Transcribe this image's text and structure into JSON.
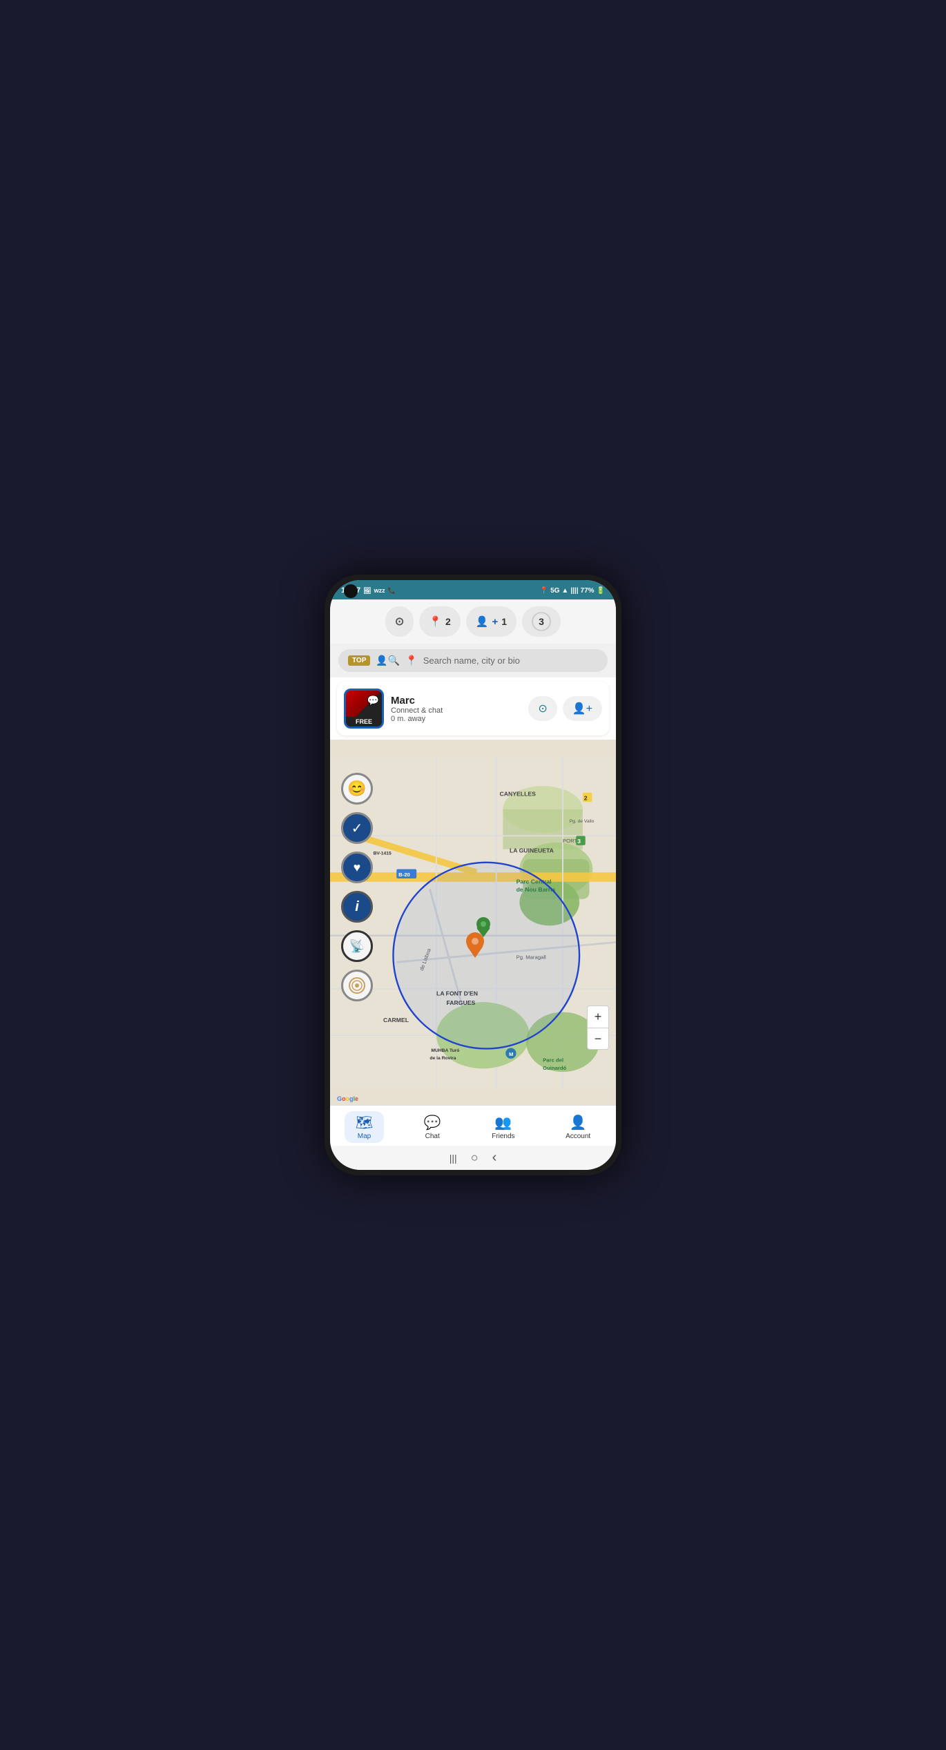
{
  "status_bar": {
    "time": "12:47",
    "network": "5G",
    "battery": "77%"
  },
  "top_actions": [
    {
      "id": "scan",
      "icon": "⊙",
      "label": "",
      "count": null
    },
    {
      "id": "messages",
      "icon": "📍",
      "label": "2",
      "count": 2
    },
    {
      "id": "add_friend",
      "icon": "👤+",
      "label": "1",
      "count": 1
    },
    {
      "id": "notifications",
      "icon": "③",
      "label": "3",
      "count": 3
    }
  ],
  "search": {
    "top_label": "TOP",
    "placeholder": "Search name, city or bio"
  },
  "user_card": {
    "name": "Marc",
    "action": "Connect & chat",
    "distance": "0 m. away",
    "free_badge": "FREE"
  },
  "map": {
    "area_labels": [
      "CANYELLES",
      "LA GUINEUETA",
      "Parc Central de Nou Barris",
      "PORTA",
      "LA FONT D'EN FARGUES",
      "CARMEL",
      "MUHBA Turó de la Rovira",
      "Parc del Guinardó",
      "Pg. de Vallo",
      "Pg. Maragall"
    ],
    "road_labels": [
      "BV-1415",
      "B-20"
    ],
    "zoom_plus": "+",
    "zoom_minus": "−"
  },
  "bottom_nav": {
    "items": [
      {
        "id": "map",
        "icon": "🗺",
        "label": "Map",
        "active": true
      },
      {
        "id": "chat",
        "icon": "💬",
        "label": "Chat",
        "active": false
      },
      {
        "id": "friends",
        "icon": "👥",
        "label": "Friends",
        "active": false
      },
      {
        "id": "account",
        "icon": "👤",
        "label": "Account",
        "active": false
      }
    ]
  },
  "home_indicator": {
    "back": "‹",
    "home": "○",
    "recents": "|||"
  }
}
